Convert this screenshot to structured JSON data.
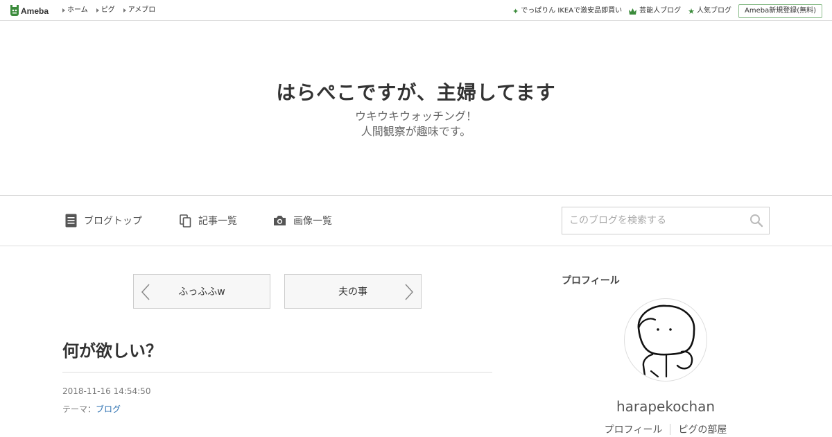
{
  "topbar": {
    "logo_text": "Ameba",
    "nav": [
      {
        "label": "ホーム"
      },
      {
        "label": "ピグ"
      },
      {
        "label": "アメブロ"
      }
    ],
    "right_links": [
      {
        "icon": "sparkle-icon",
        "label": "でっぱりん IKEAで激安品即買い"
      },
      {
        "icon": "crown-icon",
        "label": "芸能人ブログ"
      },
      {
        "icon": "star-icon",
        "label": "人気ブログ"
      }
    ],
    "register_label": "Ameba新規登録(無料)",
    "accent": "#3b8b3b"
  },
  "header": {
    "title": "はらぺこですが、主婦してます",
    "desc_line1": "ウキウキウォッチング！",
    "desc_line2": "人間観察が趣味です。"
  },
  "nav": {
    "blog_top": "ブログトップ",
    "article_list": "記事一覧",
    "image_list": "画像一覧",
    "search_placeholder": "このブログを検索する"
  },
  "pager": {
    "prev_label": "ふっふふw",
    "next_label": "夫の事"
  },
  "article": {
    "title": "何が欲しい？",
    "date": "2018-11-16 14:54:50",
    "theme_prefix": "テーマ：",
    "theme_link": "ブログ"
  },
  "sidebar": {
    "heading": "プロフィール",
    "username": "harapekochan",
    "links": [
      {
        "label": "プロフィール"
      },
      {
        "label": "ピグの部屋"
      }
    ]
  }
}
